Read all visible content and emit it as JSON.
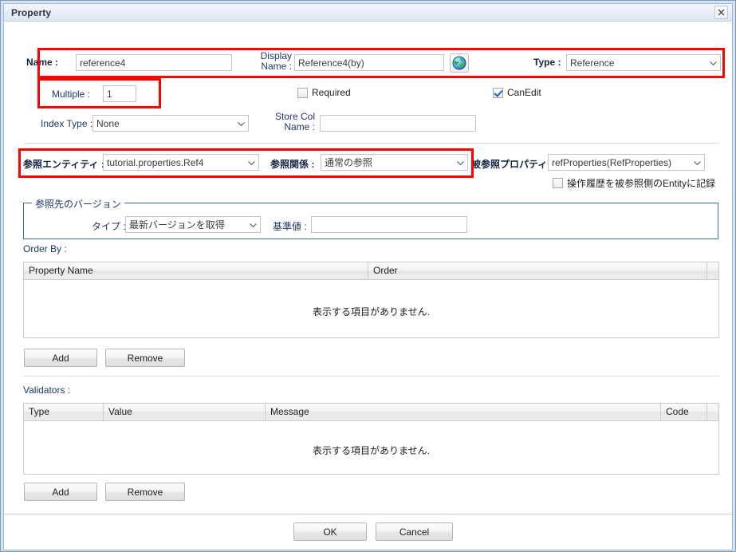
{
  "window": {
    "title": "Property",
    "close_icon": "close-icon"
  },
  "form": {
    "name_label": "Name :",
    "name_value": "reference4",
    "display_name_label_1": "Display",
    "display_name_label_2": "Name :",
    "display_name_value": "Reference4(by)",
    "globe_icon": "globe-icon",
    "type_label": "Type :",
    "type_value": "Reference",
    "multiple_label": "Multiple :",
    "multiple_value": "1",
    "required_label": "Required",
    "required_checked": false,
    "canedit_label": "CanEdit",
    "canedit_checked": true,
    "index_type_label": "Index Type :",
    "index_type_value": "None",
    "store_col_label_1": "Store Col",
    "store_col_label_2": "Name :",
    "store_col_value": "",
    "ref_entity_label": "参照エンティティ :",
    "ref_entity_value": "tutorial.properties.Ref4",
    "ref_relation_label": "参照関係 :",
    "ref_relation_value": "通常の参照",
    "referenced_prop_label": "被参照プロパティ :",
    "referenced_prop_value": "refProperties(RefProperties)",
    "history_label": "操作履歴を被参照側のEntityに記録",
    "history_checked": false
  },
  "version_group": {
    "legend": "参照先のバージョン",
    "type_label": "タイプ :",
    "type_value": "最新バージョンを取得",
    "base_label": "基準値 :",
    "base_value": ""
  },
  "order_by": {
    "section_label": "Order By :",
    "columns": [
      "Property Name",
      "Order"
    ],
    "empty_message": "表示する項目がありません.",
    "add_label": "Add",
    "remove_label": "Remove"
  },
  "validators": {
    "section_label": "Validators :",
    "columns": [
      "Type",
      "Value",
      "Message",
      "Code"
    ],
    "empty_message": "表示する項目がありません.",
    "add_label": "Add",
    "remove_label": "Remove"
  },
  "footer": {
    "ok_label": "OK",
    "cancel_label": "Cancel"
  },
  "colors": {
    "highlight": "#ff0000",
    "label_text": "#1f3864",
    "fieldset_border": "#3b6ea5",
    "checkbox_check": "#1a63c4"
  }
}
